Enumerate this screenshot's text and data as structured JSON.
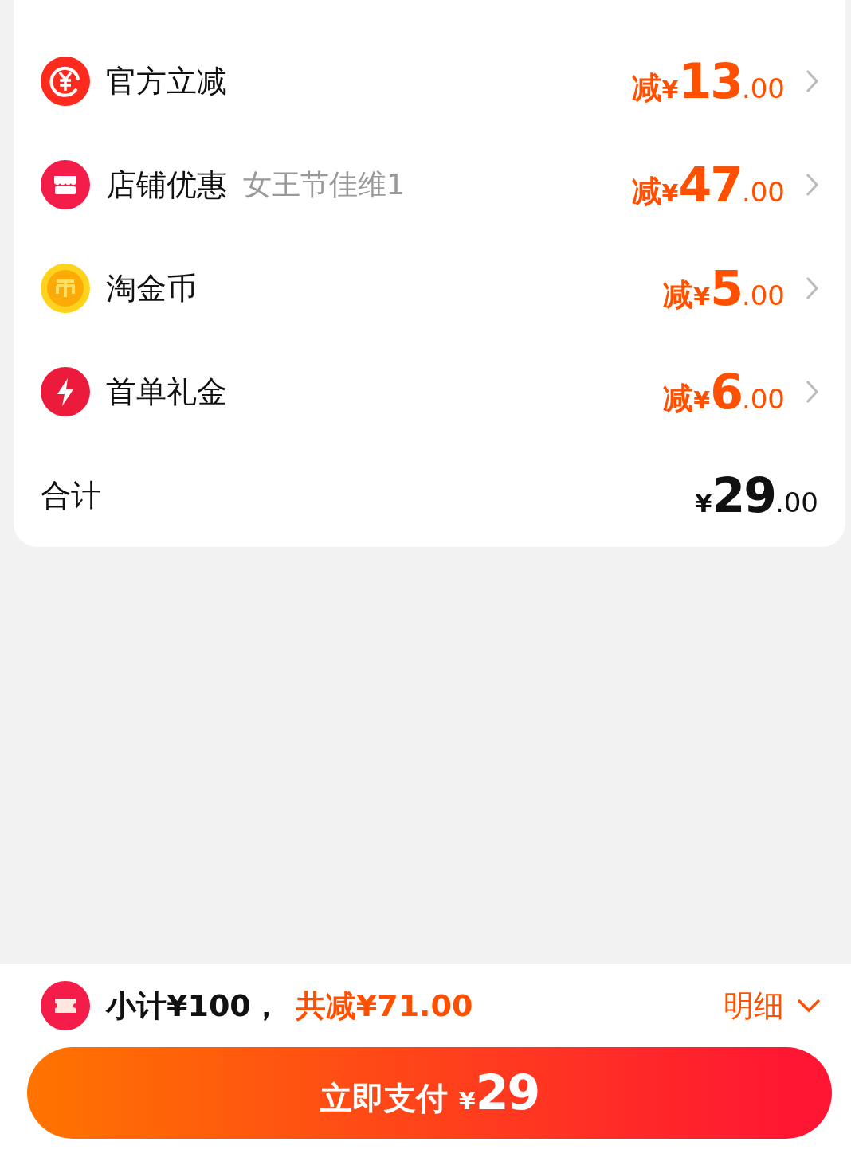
{
  "discounts": [
    {
      "kind": "yuan",
      "label": "官方立减",
      "prefix": "减",
      "currency": "¥",
      "integer": "13",
      "decimal": ".00"
    },
    {
      "kind": "store",
      "label": "店铺优惠",
      "note": "女王节佳维1",
      "prefix": "减",
      "currency": "¥",
      "integer": "47",
      "decimal": ".00"
    },
    {
      "kind": "coin",
      "label": "淘金币",
      "prefix": "减",
      "currency": "¥",
      "integer": "5",
      "decimal": ".00"
    },
    {
      "kind": "bolt",
      "label": "首单礼金",
      "prefix": "减",
      "currency": "¥",
      "integer": "6",
      "decimal": ".00"
    }
  ],
  "total": {
    "label": "合计",
    "currency": "¥",
    "integer": "29",
    "decimal": ".00"
  },
  "summary": {
    "subtotal": "小计¥100，",
    "saved": "共减¥71.00",
    "details": "明细"
  },
  "pay_button": {
    "label": "立即支付",
    "currency": "¥",
    "amount": "29"
  }
}
